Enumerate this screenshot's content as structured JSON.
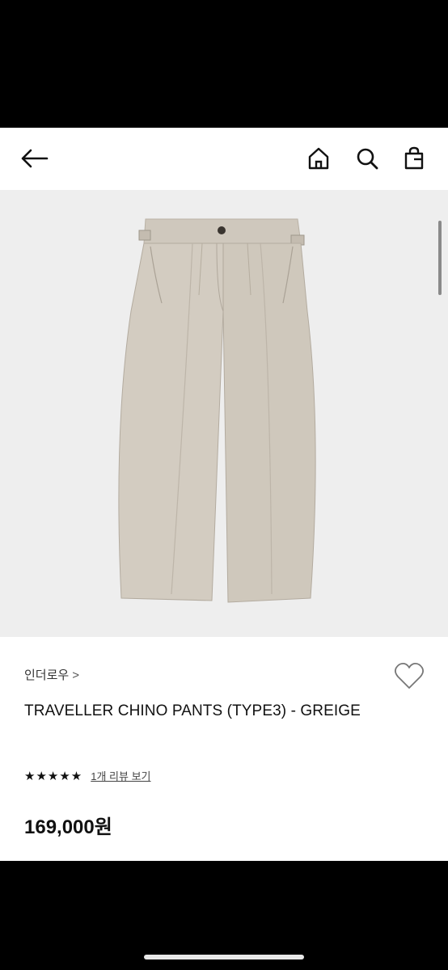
{
  "nav": {
    "back_icon": "arrow-left-icon",
    "home_icon": "home-icon",
    "search_icon": "search-icon",
    "bag_icon": "shopping-bag-icon"
  },
  "product": {
    "brand": "인더로우",
    "brand_chevron": ">",
    "title": "TRAVELLER CHINO PANTS (TYPE3) - GREIGE",
    "rating_stars": "★★★★★",
    "rating": 5,
    "review_link": "1개 리뷰 보기",
    "price": "169,000원",
    "wishlist_icon": "heart-outline-icon",
    "image_icon": "product-image-pants",
    "pants_color": "#cfc8bd"
  }
}
